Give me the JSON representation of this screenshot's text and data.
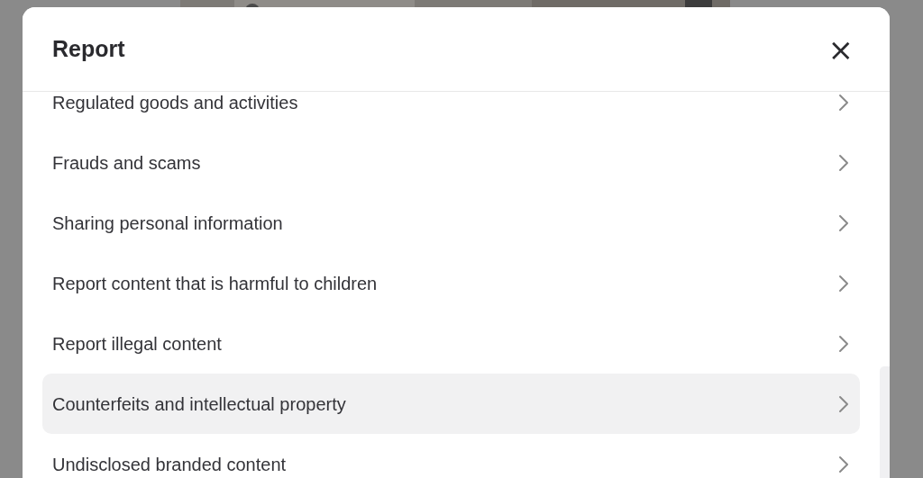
{
  "dialog": {
    "title": "Report",
    "close_label": "×",
    "items": [
      {
        "label": "Regulated goods and activities",
        "selected": false
      },
      {
        "label": "Frauds and scams",
        "selected": false
      },
      {
        "label": "Sharing personal information",
        "selected": false
      },
      {
        "label": "Report content that is harmful to children",
        "selected": false
      },
      {
        "label": "Report illegal content",
        "selected": false
      },
      {
        "label": "Counterfeits and intellectual property",
        "selected": true
      },
      {
        "label": "Undisclosed branded content",
        "selected": false
      }
    ]
  }
}
